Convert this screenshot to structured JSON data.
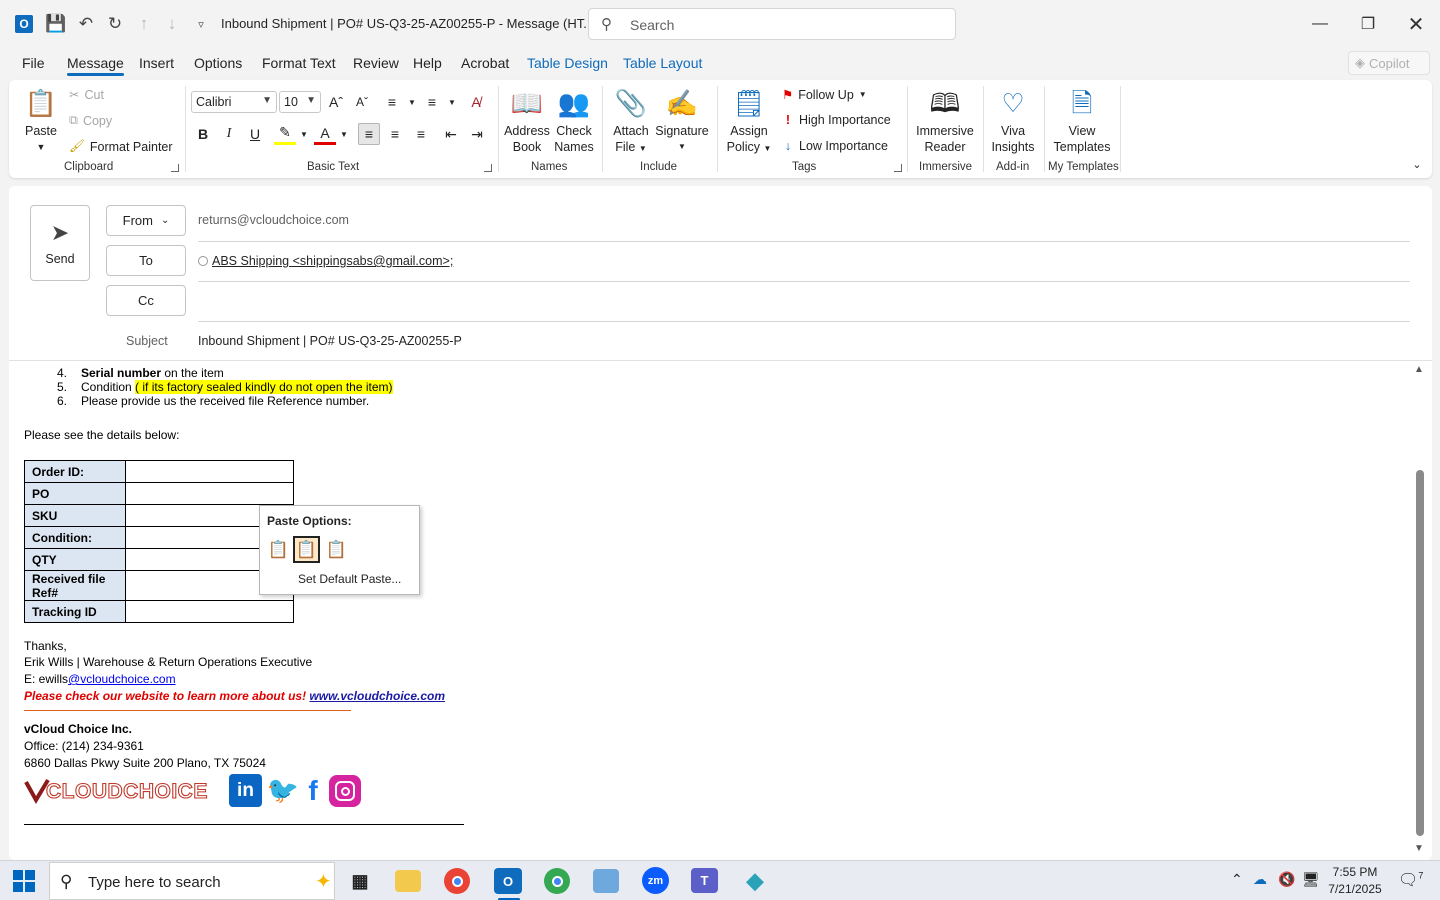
{
  "window": {
    "title": "Inbound Shipment | PO# US-Q3-25-AZ00255-P  -  Message (HT...",
    "search_placeholder": "Search",
    "copilot_label": "Copilot"
  },
  "menu_tabs": [
    "File",
    "Message",
    "Insert",
    "Options",
    "Format Text",
    "Review",
    "Help",
    "Acrobat",
    "Table Design",
    "Table Layout"
  ],
  "ribbon": {
    "clipboard": {
      "paste": "Paste",
      "cut": "Cut",
      "copy": "Copy",
      "format_painter": "Format Painter",
      "label": "Clipboard"
    },
    "basic_text": {
      "font": "Calibri",
      "size": "10",
      "label": "Basic Text"
    },
    "names": {
      "address_book_1": "Address",
      "address_book_2": "Book",
      "check_names_1": "Check",
      "check_names_2": "Names",
      "label": "Names"
    },
    "include": {
      "attach_1": "Attach",
      "attach_2": "File",
      "signature": "Signature",
      "label": "Include"
    },
    "tags": {
      "assign_1": "Assign",
      "assign_2": "Policy",
      "follow_up": "Follow Up",
      "high": "High Importance",
      "low": "Low Importance",
      "label": "Tags"
    },
    "immersive": {
      "reader_1": "Immersive",
      "reader_2": "Reader",
      "label": "Immersive"
    },
    "addin": {
      "viva_1": "Viva",
      "viva_2": "Insights",
      "label": "Add-in"
    },
    "templates": {
      "view_1": "View",
      "view_2": "Templates",
      "label": "My Templates"
    }
  },
  "compose": {
    "send": "Send",
    "from_label": "From",
    "from_value": "returns@vcloudchoice.com",
    "to_label": "To",
    "to_value": "ABS Shipping <shippingsabs@gmail.com>;",
    "cc_label": "Cc",
    "subject_label": "Subject",
    "subject_value": "Inbound Shipment | PO# US-Q3-25-AZ00255-P"
  },
  "body": {
    "list": [
      {
        "num": "4.",
        "bold": "Serial number",
        "rest": " on the item"
      },
      {
        "num": "5.",
        "pre": "Condition ",
        "highlight": "( if its factory sealed kindly do not open the item)"
      },
      {
        "num": "6.",
        "rest": "Please provide us the received file Reference number."
      }
    ],
    "details_intro": "Please see the details below:",
    "table": [
      "Order ID:",
      "PO",
      "SKU",
      "Condition:",
      "QTY",
      "Received file Ref#",
      "Tracking ID"
    ],
    "thanks": "Thanks,",
    "sig_name": "Erik Wills | Warehouse & Return Operations Executive",
    "email_prefix": "E: ewills",
    "email_link": "@vcloudchoice.com",
    "website_text": "Please check our website to learn more about us! ",
    "website_link": "www.vcloudchoice.com",
    "company": "vCloud Choice Inc.",
    "office": "Office: (214) 234-9361",
    "address": "6860 Dallas Pkwy Suite 200 Plano, TX 75024",
    "logo_text": "VCLOUDCHOICE"
  },
  "paste_menu": {
    "title": "Paste Options:",
    "set_default": "Set Default Paste..."
  },
  "taskbar": {
    "search_placeholder": "Type here to search",
    "time": "7:55 PM",
    "date": "7/21/2025",
    "notification_count": "7"
  },
  "colors": {
    "accent": "#0f6cbd",
    "highlight": "#ffff00",
    "table_key_bg": "#dce6f2",
    "signature_red": "#e00000"
  }
}
